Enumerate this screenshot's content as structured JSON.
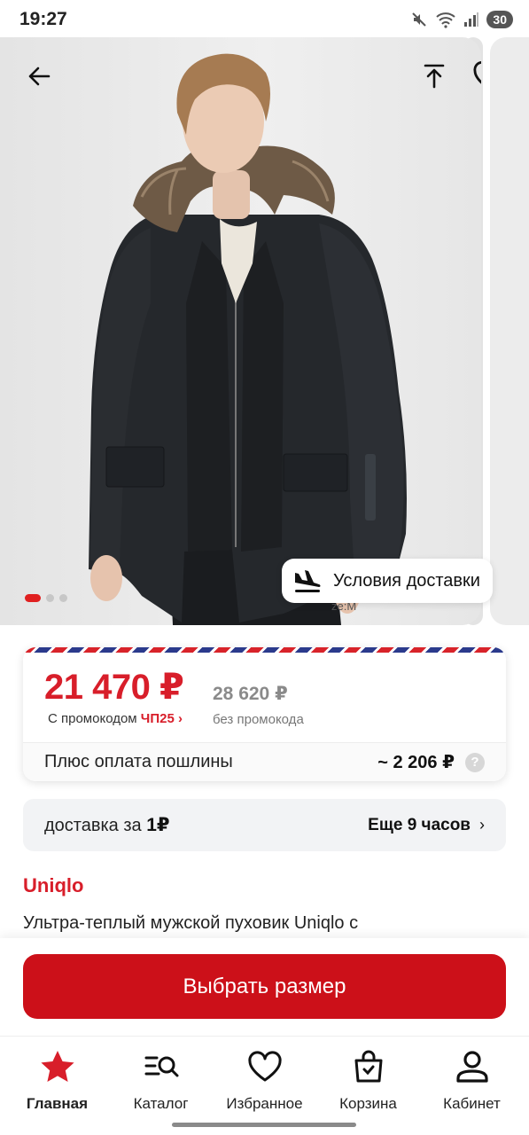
{
  "status_bar": {
    "time": "19:27",
    "battery": "30"
  },
  "hero": {
    "size_caption": "ze:M",
    "delivery_chip": "Условия доставки",
    "icons": [
      "back-arrow-icon",
      "share-icon",
      "heart-icon",
      "plane-landing-icon"
    ],
    "carousel": {
      "current": 1,
      "total": 3
    }
  },
  "price": {
    "current": "21 470 ₽",
    "old": "28 620 ₽",
    "promo_prefix": "С промокодом",
    "promo_code": "ЧП25",
    "promo_chevron": "›",
    "no_promo": "без промокода",
    "duty_label": "Плюс оплата пошлины",
    "duty_value": "~ 2 206 ₽",
    "help": "?"
  },
  "delivery": {
    "text": "доставка за",
    "price": "1₽",
    "eta": "Еще 9 часов",
    "chevron": "›"
  },
  "product": {
    "brand": "Uniqlo",
    "title": "Ультра-теплый мужской пуховик Uniqlo с"
  },
  "action": {
    "select_size": "Выбрать размер"
  },
  "nav": {
    "items": [
      {
        "label": "Главная",
        "icon": "star-icon"
      },
      {
        "label": "Каталог",
        "icon": "catalog-search-icon"
      },
      {
        "label": "Избранное",
        "icon": "heart-icon"
      },
      {
        "label": "Корзина",
        "icon": "shopping-bag-icon"
      },
      {
        "label": "Кабинет",
        "icon": "profile-icon"
      }
    ]
  },
  "colors": {
    "accent": "#d81e2a",
    "button": "#cc1019",
    "price_old": "#8a8a8a"
  }
}
